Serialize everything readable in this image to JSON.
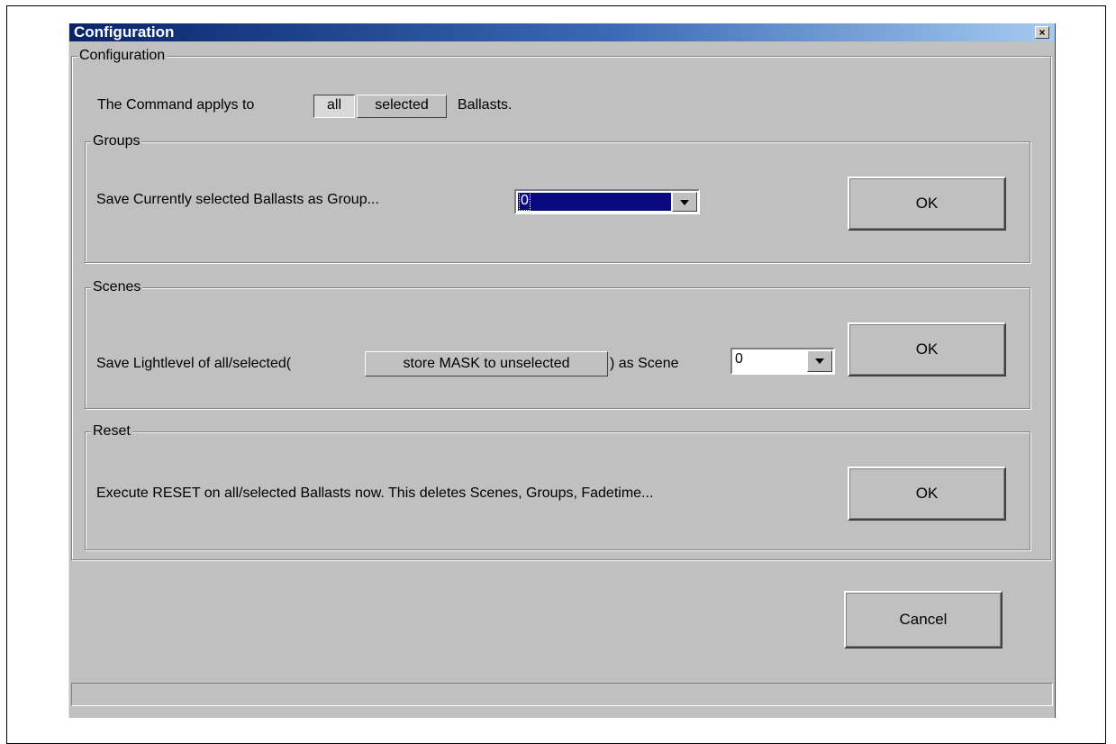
{
  "window": {
    "title": "Configuration",
    "close_glyph": "×"
  },
  "config_group": {
    "legend": "Configuration",
    "applies_prefix": "The Command applys to",
    "applies_options": [
      "all",
      "selected"
    ],
    "applies_suffix": "Ballasts."
  },
  "groups": {
    "legend": "Groups",
    "label": "Save Currently selected Ballasts as Group...",
    "combo_value": "0",
    "ok_label": "OK"
  },
  "scenes": {
    "legend": "Scenes",
    "label_before": "Save Lightlevel of all/selected(",
    "mask_button_label": "store MASK to unselected",
    "label_after": ") as Scene",
    "combo_value": "0",
    "ok_label": "OK"
  },
  "reset": {
    "legend": "Reset",
    "label": "Execute RESET on all/selected Ballasts now. This deletes Scenes, Groups, Fadetime...",
    "ok_label": "OK"
  },
  "footer": {
    "cancel_label": "Cancel"
  },
  "colors": {
    "window_bg": "#c0c0c0",
    "titlebar_start": "#0a246a",
    "titlebar_end": "#a6caf0",
    "selection_bg": "#0a0a80"
  }
}
